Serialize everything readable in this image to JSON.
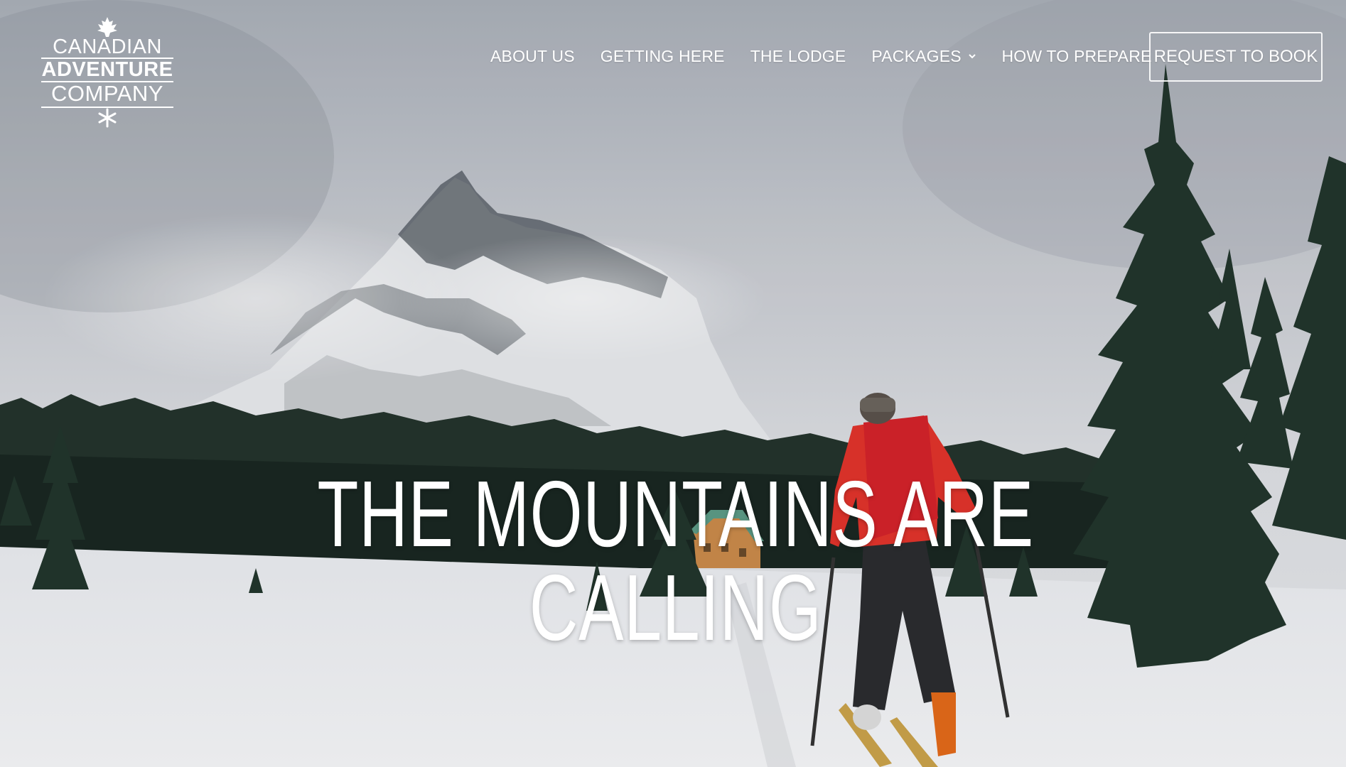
{
  "logo": {
    "line1": "CANADIAN",
    "line2": "ADVENTURE",
    "line3": "COMPANY"
  },
  "nav": {
    "items": [
      {
        "label": "ABOUT US"
      },
      {
        "label": "GETTING HERE"
      },
      {
        "label": "THE LODGE"
      },
      {
        "label": "PACKAGES",
        "has_dropdown": true
      },
      {
        "label": "HOW TO PREPARE"
      }
    ],
    "cta_label": "REQUEST TO BOOK"
  },
  "hero": {
    "headline": "THE MOUNTAINS ARE CALLING"
  },
  "colors": {
    "text": "#ffffff",
    "jacket": "#e0342b",
    "snow": "#eef0f3",
    "trees": "#1f2e26"
  }
}
